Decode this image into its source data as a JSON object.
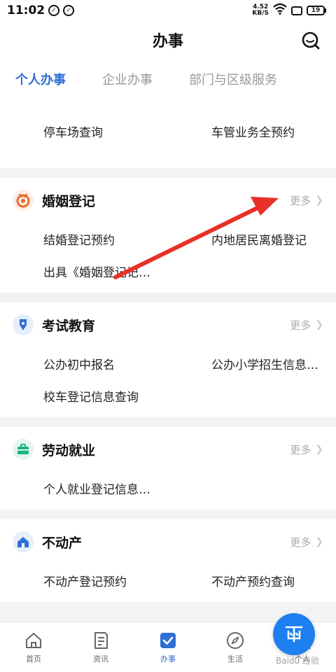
{
  "status_bar": {
    "time": "11:02",
    "net_speed_value": "4.52",
    "net_speed_unit": "KB/S",
    "battery": "19"
  },
  "header": {
    "title": "办事"
  },
  "tabs": [
    {
      "label": "个人办事",
      "active": true
    },
    {
      "label": "企业办事",
      "active": false
    },
    {
      "label": "部门与区级服务",
      "active": false
    }
  ],
  "partial_card": {
    "items": [
      "停车场查询",
      "车管业务全预约"
    ]
  },
  "categories": [
    {
      "title": "婚姻登记",
      "icon": "marriage-icon",
      "more": "更多",
      "items": [
        "结婚登记预约",
        "内地居民离婚登记",
        "出具《婚姻登记记…"
      ]
    },
    {
      "title": "考试教育",
      "icon": "education-pen-icon",
      "more": "更多",
      "items": [
        "公办初中报名",
        "公办小学招生信息…",
        "校车登记信息查询"
      ]
    },
    {
      "title": "劳动就业",
      "icon": "briefcase-icon",
      "more": "更多",
      "items": [
        "个人就业登记信息…"
      ]
    },
    {
      "title": "不动产",
      "icon": "house-icon",
      "more": "更多",
      "items": [
        "不动产登记预约",
        "不动产预约查询"
      ]
    }
  ],
  "bottom_nav": [
    {
      "label": "首页",
      "icon": "home-icon",
      "active": false
    },
    {
      "label": "资讯",
      "icon": "news-icon",
      "active": false
    },
    {
      "label": "办事",
      "icon": "checkbox-icon",
      "active": true
    },
    {
      "label": "生活",
      "icon": "compass-icon",
      "active": false
    },
    {
      "label": "个人",
      "icon": "person-icon",
      "active": false
    }
  ],
  "colors": {
    "accent": "#2f6fd6",
    "annotation_arrow": "#e8302a",
    "marriage_icon": "#ee6a2f",
    "education_icon": "#2f6fd6",
    "briefcase_icon": "#19b37d",
    "house_icon": "#2f6fd6"
  }
}
